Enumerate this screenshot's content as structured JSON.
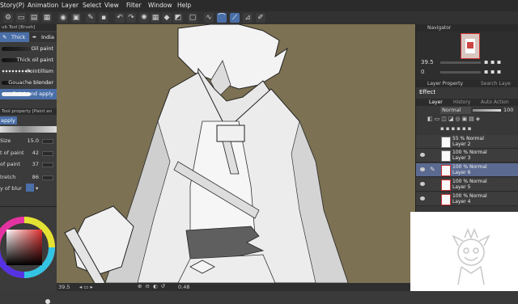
{
  "menubar": {
    "items": [
      {
        "id": "story",
        "label": "Story(P)"
      },
      {
        "id": "animation",
        "label": "Animation"
      },
      {
        "id": "layer",
        "label": "Layer"
      },
      {
        "id": "select",
        "label": "Select"
      },
      {
        "id": "view",
        "label": "View"
      },
      {
        "id": "filter",
        "label": "Filter"
      },
      {
        "id": "window",
        "label": "Window"
      },
      {
        "id": "help",
        "label": "Help"
      }
    ]
  },
  "sub_tool": {
    "header": "ub Tool [Brush]",
    "tab_active": "Thick",
    "tab_other": "India",
    "brushes": [
      {
        "label": "Oil paint"
      },
      {
        "label": "Thick oil paint"
      },
      {
        "label": "Pointillism"
      },
      {
        "label": "Gouache blender"
      },
      {
        "label": "Paint and apply"
      }
    ]
  },
  "tool_property": {
    "header": "Tool property [Paint an",
    "tool_name": "apply",
    "size_label": "Size",
    "size_value": "15.0",
    "props": [
      {
        "name": "t of paint",
        "value": "42"
      },
      {
        "name": "of paint",
        "value": "37"
      },
      {
        "name": "tretch",
        "value": "86"
      },
      {
        "name": "y of blur",
        "value": ""
      }
    ]
  },
  "canvas": {
    "zoom_value": "39.5",
    "angle_value": "0.0"
  },
  "status": {
    "zoom": "39.5",
    "position": "0.48"
  },
  "navigator": {
    "title": "Navigator",
    "zoom": "39.5"
  },
  "layer_property": {
    "title": "Layer Property",
    "search": "Search Laye"
  },
  "effect_label": "Effect",
  "layer_tabs": {
    "layer": "Layer",
    "history": "History",
    "auto": "Auto Action"
  },
  "blend": {
    "mode": "Normal",
    "opacity": "100"
  },
  "layers": [
    {
      "line1": "55 % Normal",
      "line2": "Layer 2",
      "selected": false,
      "red": false
    },
    {
      "line1": "100 % Normal",
      "line2": "Layer 3",
      "selected": false,
      "red": false
    },
    {
      "line1": "100 % Normal",
      "line2": "Layer 6",
      "selected": true,
      "red": true
    },
    {
      "line1": "100 % Normal",
      "line2": "Layer 5",
      "selected": false,
      "red": true
    },
    {
      "line1": "100 % Normal",
      "line2": "Layer 4",
      "selected": false,
      "red": true
    }
  ],
  "colors": {
    "canvas_bg": "#7c7152",
    "accent": "#4a6fa8",
    "selected_layer": "#5b6a90"
  }
}
